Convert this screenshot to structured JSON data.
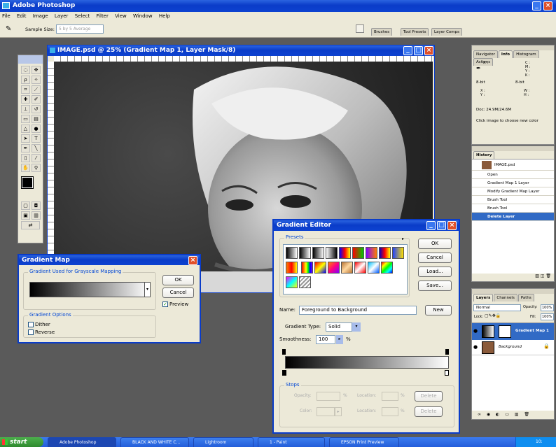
{
  "app": {
    "title": "Adobe Photoshop"
  },
  "menu": [
    "File",
    "Edit",
    "Image",
    "Layer",
    "Select",
    "Filter",
    "View",
    "Window",
    "Help"
  ],
  "options_bar": {
    "sample_label": "Sample Size:",
    "sample_value": "5 by 5 Average",
    "tabs": [
      "Brushes",
      "Tool Presets",
      "Layer Comps"
    ]
  },
  "document": {
    "title": "IMAGE.psd @ 25% (Gradient Map 1, Layer Mask/8)"
  },
  "info_panel": {
    "tabs": [
      "Navigator",
      "Info",
      "Histogram",
      "Actions"
    ],
    "left_channel": "K :",
    "right_channel": "C :\nM :\nY :\nK :",
    "bit_left": "8-bit",
    "bit_right": "8-bit",
    "xy": "X :\nY :",
    "wh": "W :\nH :",
    "doc": "Doc: 24.9M/24.6M",
    "hint": "Click image to choose new color"
  },
  "history_panel": {
    "tab": "History",
    "snapshot": "IMAGE.psd",
    "items": [
      "Open",
      "Gradient Map 1 Layer",
      "Modify Gradient Map Layer",
      "Brush Tool",
      "Brush Tool",
      "Delete Layer"
    ]
  },
  "layers_panel": {
    "tabs": [
      "Layers",
      "Channels",
      "Paths"
    ],
    "blend": "Normal",
    "opacity_label": "Opacity:",
    "opacity": "100%",
    "lock_label": "Lock:",
    "fill_label": "Fill:",
    "fill": "100%",
    "layers": [
      "Gradient Map 1",
      "Background"
    ]
  },
  "gradient_map": {
    "title": "Gradient Map",
    "group1": "Gradient Used for Grayscale Mapping",
    "ok": "OK",
    "cancel": "Cancel",
    "preview": "Preview",
    "group2": "Gradient Options",
    "dither": "Dither",
    "reverse": "Reverse"
  },
  "gradient_editor": {
    "title": "Gradient Editor",
    "presets": "Presets",
    "ok": "OK",
    "cancel": "Cancel",
    "load": "Load...",
    "save": "Save...",
    "name_label": "Name:",
    "name_value": "Foreground to Background",
    "new": "New",
    "type_label": "Gradient Type:",
    "type_value": "Solid",
    "smooth_label": "Smoothness:",
    "smooth_value": "100",
    "pct": "%",
    "stops": "Stops",
    "opacity_label": "Opacity:",
    "color_label": "Color:",
    "location_label": "Location:",
    "delete": "Delete"
  },
  "taskbar": {
    "start": "start",
    "items": [
      "Adobe Photoshop",
      "BLACK AND WHITE C...",
      "Lightroom",
      "1 - Paint",
      "EPSON Print Preview"
    ],
    "clock": "10:"
  },
  "colors": {
    "titlebar": "#0a3cc8",
    "dialog_bg": "#ece9d8",
    "selection": "#316ac5",
    "taskbar": "#245edb",
    "start": "#3c9a3c"
  }
}
